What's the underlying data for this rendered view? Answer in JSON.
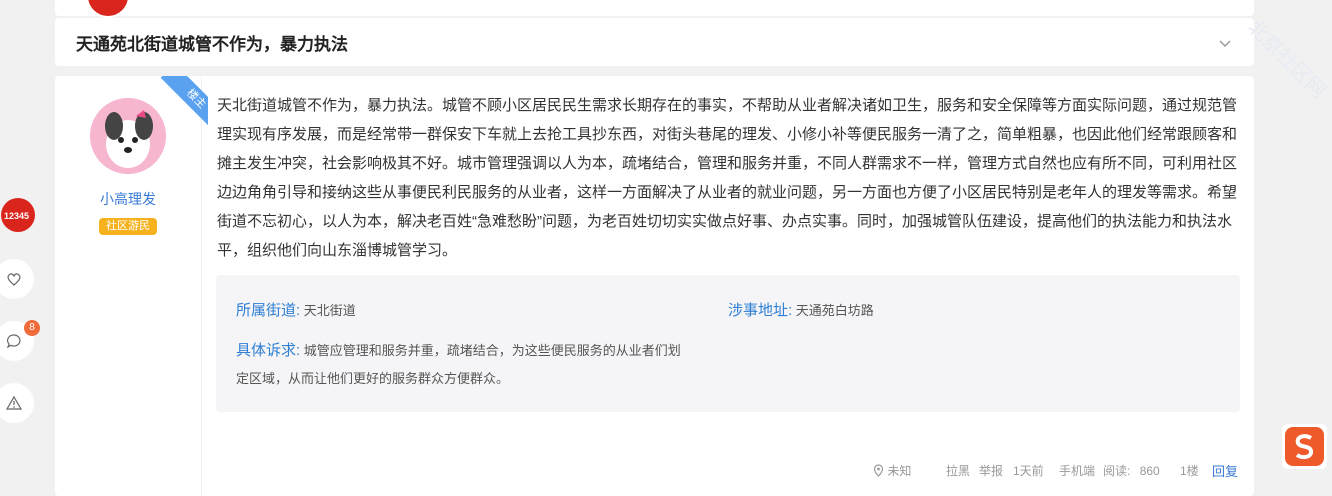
{
  "post_title": "天通苑北街道城管不作为，暴力执法",
  "author": {
    "name": "小高理发",
    "badge": "社区游民",
    "floor_tag": "楼主"
  },
  "content": "天北街道城管不作为，暴力执法。城管不顾小区居民民生需求长期存在的事实，不帮助从业者解决诸如卫生，服务和安全保障等方面实际问题，通过规范管理实现有序发展，而是经常带一群保安下车就上去抢工具抄东西，对街头巷尾的理发、小修小补等便民服务一清了之，简单粗暴，也因此他们经常跟顾客和摊主发生冲突，社会影响极其不好。城市管理强调以人为本，疏堵结合，管理和服务并重，不同人群需求不一样，管理方式自然也应有所不同，可利用社区边边角角引导和接纳这些从事便民利民服务的从业者，这样一方面解决了从业者的就业问题，另一方面也方便了小区居民特别是老年人的理发等需求。希望街道不忘初心，以人为本，解决老百姓“急难愁盼”问题，为老百姓切切实实做点好事、办点实事。同时，加强城管队伍建设，提高他们的执法能力和执法水平，组织他们向山东淄博城管学习。",
  "info": {
    "street_label": "所属街道:",
    "street_value": "天北街道",
    "address_label": "涉事地址:",
    "address_value": "天通苑白坊路",
    "detail_label": "具体诉求:",
    "detail_line1": "城管应管理和服务并重，疏堵结合，为这些便民服务的从业者们划",
    "detail_line2": "定区域，从而让他们更好的服务群众方便群众。"
  },
  "footer": {
    "location": "未知",
    "block": "拉黑",
    "report": "举报",
    "time": "1天前",
    "device": "手机端",
    "views_label": "阅读:",
    "views": "860",
    "floor": "1楼",
    "reply": "回复"
  },
  "float_bar": {
    "logo_text": "12345",
    "message_count": "8"
  },
  "watermark": "北京社区网",
  "colors": {
    "accent": "#3a7bd5",
    "badge": "#f5b21e",
    "brand_red": "#d9251c",
    "ribbon": "#5aa2f0"
  }
}
